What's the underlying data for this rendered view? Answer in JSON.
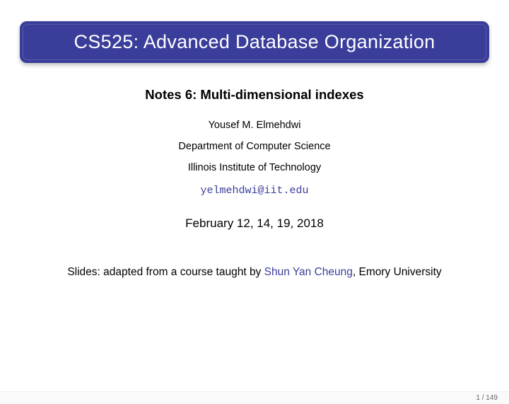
{
  "title": "CS525: Advanced Database Organization",
  "subtitle": "Notes 6: Multi-dimensional indexes",
  "author": "Yousef M. Elmehdwi",
  "department": "Department of Computer Science",
  "institution": "Illinois Institute of Technology",
  "email": "yelmehdwi@iit.edu",
  "date": "February 12, 14, 19, 2018",
  "credits_prefix": "Slides: adapted from a course taught by ",
  "credits_name": "Shun Yan Cheung",
  "credits_suffix": ", Emory University",
  "page_number": "1 / 149"
}
